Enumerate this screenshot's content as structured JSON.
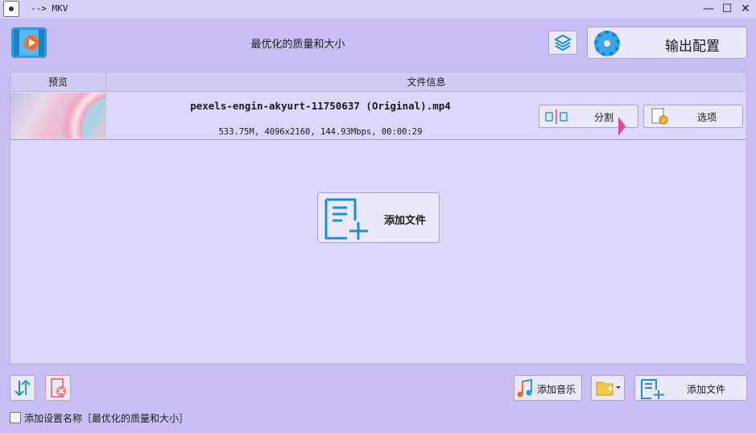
{
  "window": {
    "title": "--> MKV",
    "minimize": "—",
    "maximize": "☐",
    "close": "✕"
  },
  "header": {
    "preset_title": "最优化的质量和大小",
    "output_config_label": "输出配置"
  },
  "table": {
    "columns": [
      "预览",
      "文件信息"
    ],
    "rows": [
      {
        "filename": "pexels-engin-akyurt-11750637 (Original).mp4",
        "meta": "533.75M, 4096x2160, 144.93Mbps, 00:00:29",
        "split_label": "分割",
        "options_label": "选项"
      }
    ]
  },
  "center": {
    "add_file_label": "添加文件"
  },
  "bottom": {
    "add_music_label": "添加音乐",
    "add_file_label": "添加文件",
    "checkbox_label": "添加设置名称［最优化的质量和大小］",
    "checkbox_checked": false
  },
  "colors": {
    "background": "#c9bff5",
    "accent": "#2a9be0",
    "play": "#ff6a2b"
  }
}
